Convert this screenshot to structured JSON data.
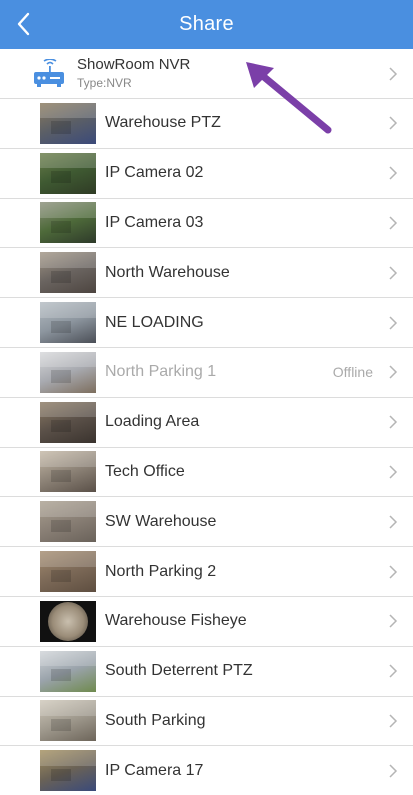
{
  "header": {
    "title": "Share"
  },
  "nvr": {
    "name": "ShowRoom NVR",
    "type": "Type:NVR"
  },
  "cameras": [
    {
      "name": "Warehouse PTZ",
      "status": "",
      "thumb": [
        "#5b5f66",
        "#8a7a5e",
        "#3b4a7a"
      ]
    },
    {
      "name": "IP Camera 02",
      "status": "",
      "thumb": [
        "#3f5a32",
        "#6a7d4a",
        "#2f3b25"
      ]
    },
    {
      "name": "IP Camera 03",
      "status": "",
      "thumb": [
        "#4e6a3a",
        "#8a8f7a",
        "#2e3a2a"
      ]
    },
    {
      "name": "North Warehouse",
      "status": "",
      "thumb": [
        "#6a6460",
        "#a19585",
        "#4d4540"
      ]
    },
    {
      "name": "NE LOADING",
      "status": "",
      "thumb": [
        "#8d969f",
        "#b4bcc2",
        "#4b4f57"
      ]
    },
    {
      "name": "North Parking 1",
      "status": "Offline",
      "thumb": [
        "#a8aab0",
        "#d7d8da",
        "#7d6e5e"
      ]
    },
    {
      "name": "Loading Area",
      "status": "",
      "thumb": [
        "#5a5048",
        "#8b7a64",
        "#3a332e"
      ]
    },
    {
      "name": "Tech Office",
      "status": "",
      "thumb": [
        "#8e8478",
        "#c4b8a6",
        "#5a5048"
      ]
    },
    {
      "name": "SW Warehouse",
      "status": "",
      "thumb": [
        "#8a8076",
        "#aaa090",
        "#6a625a"
      ]
    },
    {
      "name": "North Parking 2",
      "status": "",
      "thumb": [
        "#7d6a58",
        "#a48c70",
        "#5e4e40"
      ]
    },
    {
      "name": "Warehouse Fisheye",
      "status": "",
      "thumb": [
        "#111111",
        "#9a8c78",
        "#c9bfae"
      ]
    },
    {
      "name": "South Deterrent PTZ",
      "status": "",
      "thumb": [
        "#9aa3ab",
        "#d0d4d8",
        "#6f8a4e"
      ]
    },
    {
      "name": "South Parking",
      "status": "",
      "thumb": [
        "#a09a8e",
        "#cfc8ba",
        "#6d655a"
      ]
    },
    {
      "name": "IP Camera 17",
      "status": "",
      "thumb": [
        "#6a6256",
        "#a49060",
        "#3a4a7a"
      ]
    }
  ],
  "colors": {
    "header": "#4a8fe0",
    "annotation_arrow": "#7b3fa8",
    "divider": "#dcdcdc"
  },
  "icons": {
    "back": "chevron-left-icon",
    "row": "chevron-right-icon",
    "nvr": "nvr-device-icon"
  }
}
